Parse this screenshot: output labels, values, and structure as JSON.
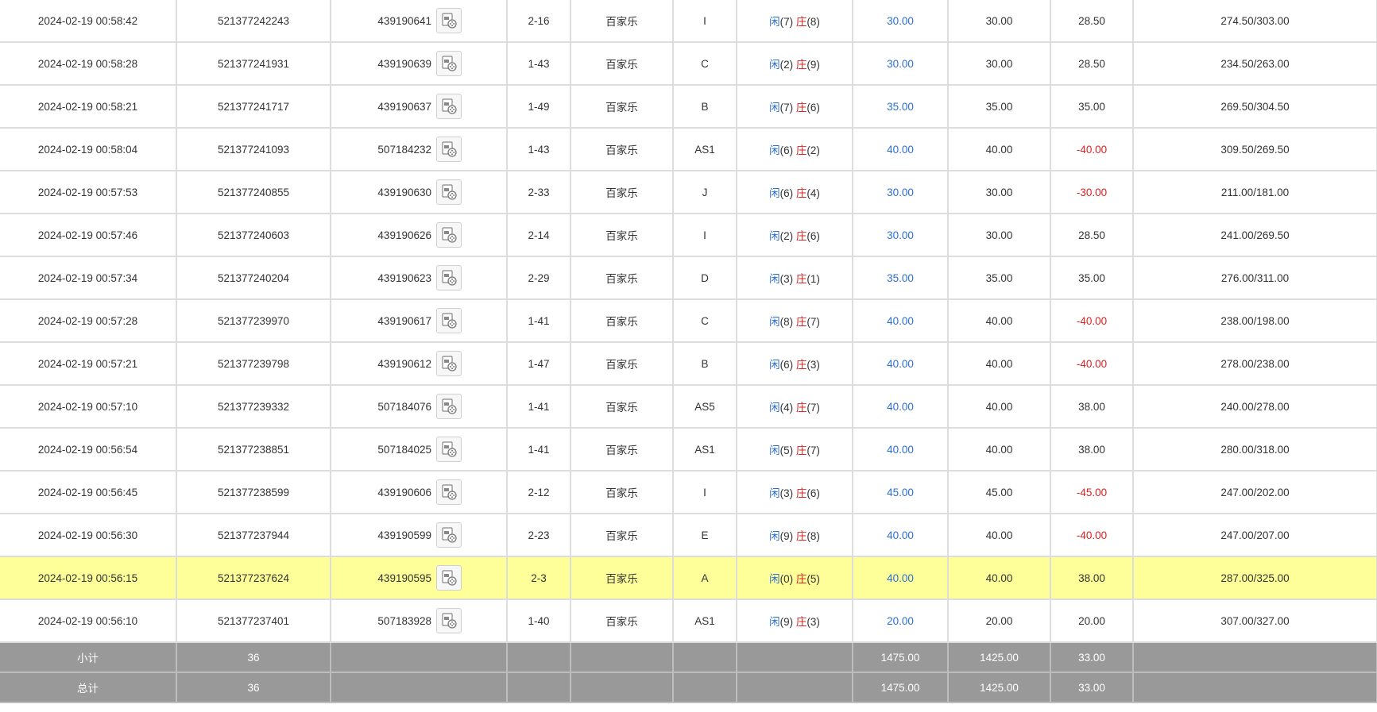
{
  "labels": {
    "player": "闲",
    "banker": "庄"
  },
  "rows": [
    {
      "time": "2024-02-19 00:58:42",
      "bet_id": "521377242243",
      "game_id": "439190641",
      "shoe": "2-16",
      "game": "百家乐",
      "table": "I",
      "result_player": "(7)",
      "result_banker": "(8)",
      "bet": "30.00",
      "valid": "30.00",
      "win": "28.50",
      "balance": "274.50/303.00",
      "win_negative": false,
      "highlight": false
    },
    {
      "time": "2024-02-19 00:58:28",
      "bet_id": "521377241931",
      "game_id": "439190639",
      "shoe": "1-43",
      "game": "百家乐",
      "table": "C",
      "result_player": "(2)",
      "result_banker": "(9)",
      "bet": "30.00",
      "valid": "30.00",
      "win": "28.50",
      "balance": "234.50/263.00",
      "win_negative": false,
      "highlight": false
    },
    {
      "time": "2024-02-19 00:58:21",
      "bet_id": "521377241717",
      "game_id": "439190637",
      "shoe": "1-49",
      "game": "百家乐",
      "table": "B",
      "result_player": "(7)",
      "result_banker": "(6)",
      "bet": "35.00",
      "valid": "35.00",
      "win": "35.00",
      "balance": "269.50/304.50",
      "win_negative": false,
      "highlight": false
    },
    {
      "time": "2024-02-19 00:58:04",
      "bet_id": "521377241093",
      "game_id": "507184232",
      "shoe": "1-43",
      "game": "百家乐",
      "table": "AS1",
      "result_player": "(6)",
      "result_banker": "(2)",
      "bet": "40.00",
      "valid": "40.00",
      "win": "-40.00",
      "balance": "309.50/269.50",
      "win_negative": true,
      "highlight": false
    },
    {
      "time": "2024-02-19 00:57:53",
      "bet_id": "521377240855",
      "game_id": "439190630",
      "shoe": "2-33",
      "game": "百家乐",
      "table": "J",
      "result_player": "(6)",
      "result_banker": "(4)",
      "bet": "30.00",
      "valid": "30.00",
      "win": "-30.00",
      "balance": "211.00/181.00",
      "win_negative": true,
      "highlight": false
    },
    {
      "time": "2024-02-19 00:57:46",
      "bet_id": "521377240603",
      "game_id": "439190626",
      "shoe": "2-14",
      "game": "百家乐",
      "table": "I",
      "result_player": "(2)",
      "result_banker": "(6)",
      "bet": "30.00",
      "valid": "30.00",
      "win": "28.50",
      "balance": "241.00/269.50",
      "win_negative": false,
      "highlight": false
    },
    {
      "time": "2024-02-19 00:57:34",
      "bet_id": "521377240204",
      "game_id": "439190623",
      "shoe": "2-29",
      "game": "百家乐",
      "table": "D",
      "result_player": "(3)",
      "result_banker": "(1)",
      "bet": "35.00",
      "valid": "35.00",
      "win": "35.00",
      "balance": "276.00/311.00",
      "win_negative": false,
      "highlight": false
    },
    {
      "time": "2024-02-19 00:57:28",
      "bet_id": "521377239970",
      "game_id": "439190617",
      "shoe": "1-41",
      "game": "百家乐",
      "table": "C",
      "result_player": "(8)",
      "result_banker": "(7)",
      "bet": "40.00",
      "valid": "40.00",
      "win": "-40.00",
      "balance": "238.00/198.00",
      "win_negative": true,
      "highlight": false
    },
    {
      "time": "2024-02-19 00:57:21",
      "bet_id": "521377239798",
      "game_id": "439190612",
      "shoe": "1-47",
      "game": "百家乐",
      "table": "B",
      "result_player": "(6)",
      "result_banker": "(3)",
      "bet": "40.00",
      "valid": "40.00",
      "win": "-40.00",
      "balance": "278.00/238.00",
      "win_negative": true,
      "highlight": false
    },
    {
      "time": "2024-02-19 00:57:10",
      "bet_id": "521377239332",
      "game_id": "507184076",
      "shoe": "1-41",
      "game": "百家乐",
      "table": "AS5",
      "result_player": "(4)",
      "result_banker": "(7)",
      "bet": "40.00",
      "valid": "40.00",
      "win": "38.00",
      "balance": "240.00/278.00",
      "win_negative": false,
      "highlight": false
    },
    {
      "time": "2024-02-19 00:56:54",
      "bet_id": "521377238851",
      "game_id": "507184025",
      "shoe": "1-41",
      "game": "百家乐",
      "table": "AS1",
      "result_player": "(5)",
      "result_banker": "(7)",
      "bet": "40.00",
      "valid": "40.00",
      "win": "38.00",
      "balance": "280.00/318.00",
      "win_negative": false,
      "highlight": false
    },
    {
      "time": "2024-02-19 00:56:45",
      "bet_id": "521377238599",
      "game_id": "439190606",
      "shoe": "2-12",
      "game": "百家乐",
      "table": "I",
      "result_player": "(3)",
      "result_banker": "(6)",
      "bet": "45.00",
      "valid": "45.00",
      "win": "-45.00",
      "balance": "247.00/202.00",
      "win_negative": true,
      "highlight": false
    },
    {
      "time": "2024-02-19 00:56:30",
      "bet_id": "521377237944",
      "game_id": "439190599",
      "shoe": "2-23",
      "game": "百家乐",
      "table": "E",
      "result_player": "(9)",
      "result_banker": "(8)",
      "bet": "40.00",
      "valid": "40.00",
      "win": "-40.00",
      "balance": "247.00/207.00",
      "win_negative": true,
      "highlight": false
    },
    {
      "time": "2024-02-19 00:56:15",
      "bet_id": "521377237624",
      "game_id": "439190595",
      "shoe": "2-3",
      "game": "百家乐",
      "table": "A",
      "result_player": "(0)",
      "result_banker": "(5)",
      "bet": "40.00",
      "valid": "40.00",
      "win": "38.00",
      "balance": "287.00/325.00",
      "win_negative": false,
      "highlight": true
    },
    {
      "time": "2024-02-19 00:56:10",
      "bet_id": "521377237401",
      "game_id": "507183928",
      "shoe": "1-40",
      "game": "百家乐",
      "table": "AS1",
      "result_player": "(9)",
      "result_banker": "(3)",
      "bet": "20.00",
      "valid": "20.00",
      "win": "20.00",
      "balance": "307.00/327.00",
      "win_negative": false,
      "highlight": false
    }
  ],
  "summary": [
    {
      "label": "小计",
      "count": "36",
      "bet": "1475.00",
      "valid": "1425.00",
      "win": "33.00"
    },
    {
      "label": "总计",
      "count": "36",
      "bet": "1475.00",
      "valid": "1425.00",
      "win": "33.00"
    }
  ],
  "colors": {
    "blue": "#2b6fd6",
    "red": "#e02020",
    "highlight": "#ffff99",
    "summary_bg": "#999999",
    "border": "#dddddd"
  },
  "icons": {
    "record": "video-record-icon"
  }
}
